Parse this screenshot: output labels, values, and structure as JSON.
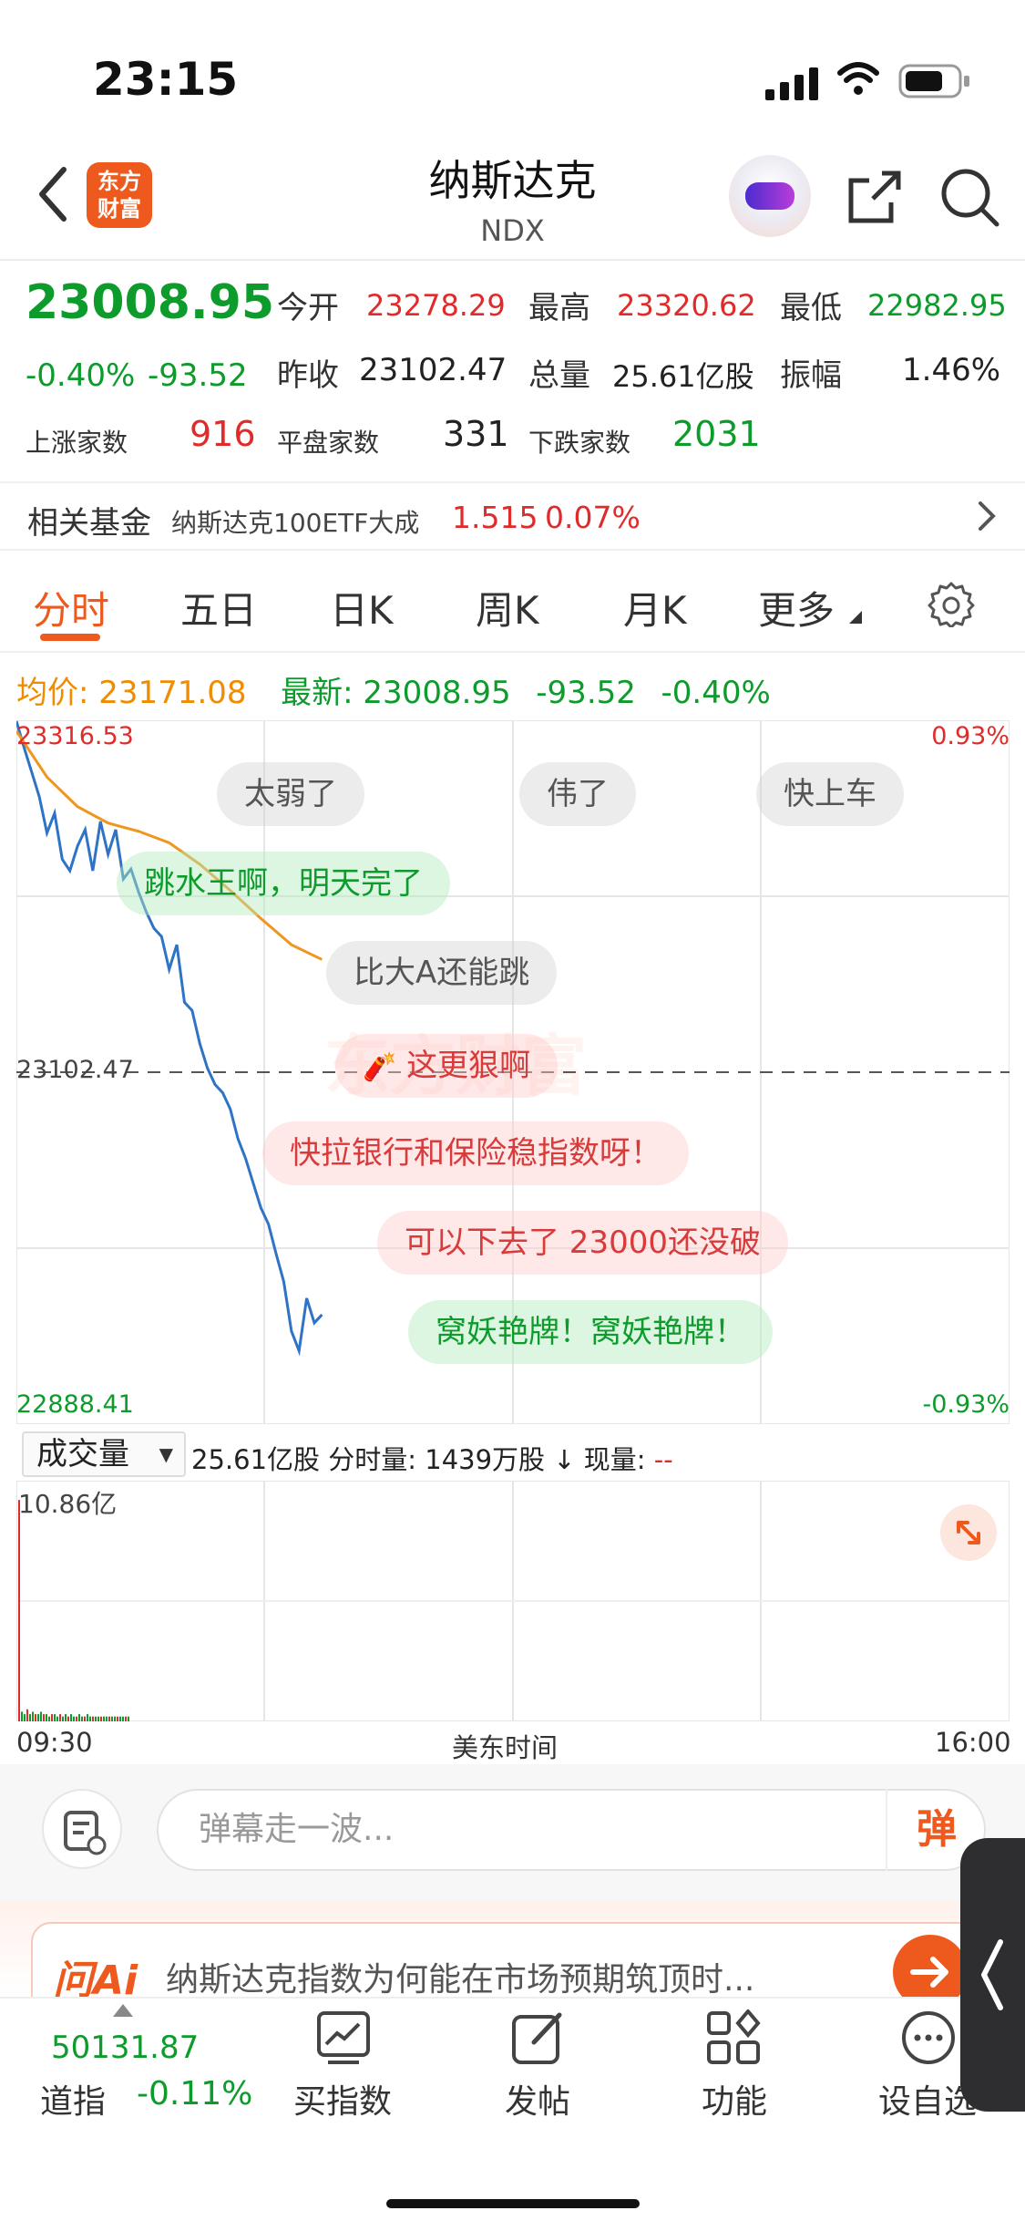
{
  "status_bar": {
    "time": "23:15"
  },
  "header": {
    "logo_line1": "东方",
    "logo_line2": "财富",
    "title": "纳斯达克",
    "subtitle": "NDX"
  },
  "quote": {
    "price": "23008.95",
    "change_pct": "-0.40%",
    "change": "-93.52",
    "open_label": "今开",
    "open": "23278.29",
    "high_label": "最高",
    "high": "23320.62",
    "low_label": "最低",
    "low": "22982.95",
    "prev_close_label": "昨收",
    "prev_close": "23102.47",
    "volume_label": "总量",
    "volume": "25.61亿股",
    "amplitude_label": "振幅",
    "amplitude": "1.46%",
    "up_label": "上涨家数",
    "up": "916",
    "flat_label": "平盘家数",
    "flat": "331",
    "down_label": "下跌家数",
    "down": "2031"
  },
  "fund": {
    "label": "相关基金",
    "name": "纳斯达克100ETF大成",
    "price": "1.515",
    "change": "0.07%"
  },
  "tabs": [
    "分时",
    "五日",
    "日K",
    "周K",
    "月K",
    "更多"
  ],
  "avg_row": {
    "avg_label": "均价:",
    "avg": "23171.08",
    "latest_label": "最新:",
    "latest": "23008.95",
    "change": "-93.52",
    "pct": "-0.40%"
  },
  "chart_labels": {
    "top_price": "23316.53",
    "mid_price": "23102.47",
    "bottom_price": "22888.41",
    "top_pct": "0.93%",
    "bottom_pct": "-0.93%",
    "watermark": "东方财富"
  },
  "danmu": [
    "太弱了",
    "伟了",
    "快上车",
    "跳水王啊，明天完了",
    "比大A还能跳",
    "这更狠啊",
    "快拉银行和保险稳指数呀！",
    "可以下去了 23000还没破",
    "窝妖艳牌！窝妖艳牌！"
  ],
  "volume": {
    "selector": "成交量",
    "info_total": "25.61亿股",
    "info_minute": "分时量: 1439万股",
    "info_now_label": "现量:",
    "info_now": "--",
    "max_label": "10.86亿",
    "time_start": "09:30",
    "time_mid": "美东时间",
    "time_end": "16:00"
  },
  "chart_data": {
    "type": "line",
    "x_label": "美东时间",
    "xlim": [
      "09:30",
      "16:00"
    ],
    "ylim": [
      22888.41,
      23316.53
    ],
    "reference": 23102.47,
    "series": [
      {
        "name": "price",
        "color": "#2e73c4",
        "x": [
          0,
          1,
          2,
          3,
          4,
          5,
          6,
          7,
          8,
          9,
          10,
          11,
          12,
          13,
          14,
          15,
          16,
          17,
          18,
          19,
          20,
          21,
          22,
          23,
          24,
          25,
          26,
          27,
          28,
          29,
          30,
          31,
          32,
          33,
          34,
          35,
          36,
          37,
          38,
          39,
          40
        ],
        "y": [
          23316,
          23300,
          23285,
          23270,
          23248,
          23260,
          23232,
          23225,
          23240,
          23250,
          23225,
          23255,
          23235,
          23250,
          23220,
          23226,
          23212,
          23200,
          23190,
          23185,
          23165,
          23180,
          23145,
          23140,
          23120,
          23105,
          23095,
          23090,
          23080,
          23062,
          23050,
          23035,
          23020,
          23010,
          22992,
          22975,
          22945,
          22933,
          22965,
          22950,
          22955
        ]
      },
      {
        "name": "average",
        "color": "#f0961e",
        "x": [
          0,
          4,
          8,
          12,
          16,
          20,
          24,
          28,
          32,
          36,
          40
        ],
        "y": [
          23310,
          23282,
          23264,
          23254,
          23249,
          23242,
          23229,
          23213,
          23196,
          23180,
          23171
        ]
      }
    ],
    "volume_max": 10.86
  },
  "comment": {
    "placeholder": "弹幕走一波...",
    "dan_label": "弹"
  },
  "ai": {
    "logo": "问Ai",
    "text": "纳斯达克指数为何能在市场预期筑顶时..."
  },
  "bottom_nav": {
    "index_value": "50131.87",
    "index_name": "道指",
    "index_pct": "-0.11%",
    "items": [
      "买指数",
      "发帖",
      "功能",
      "设自选"
    ]
  },
  "colors": {
    "accent": "#ee5a1e",
    "up": "#e02b2b",
    "down": "#0d9b2c",
    "avg": "#f08c00"
  }
}
